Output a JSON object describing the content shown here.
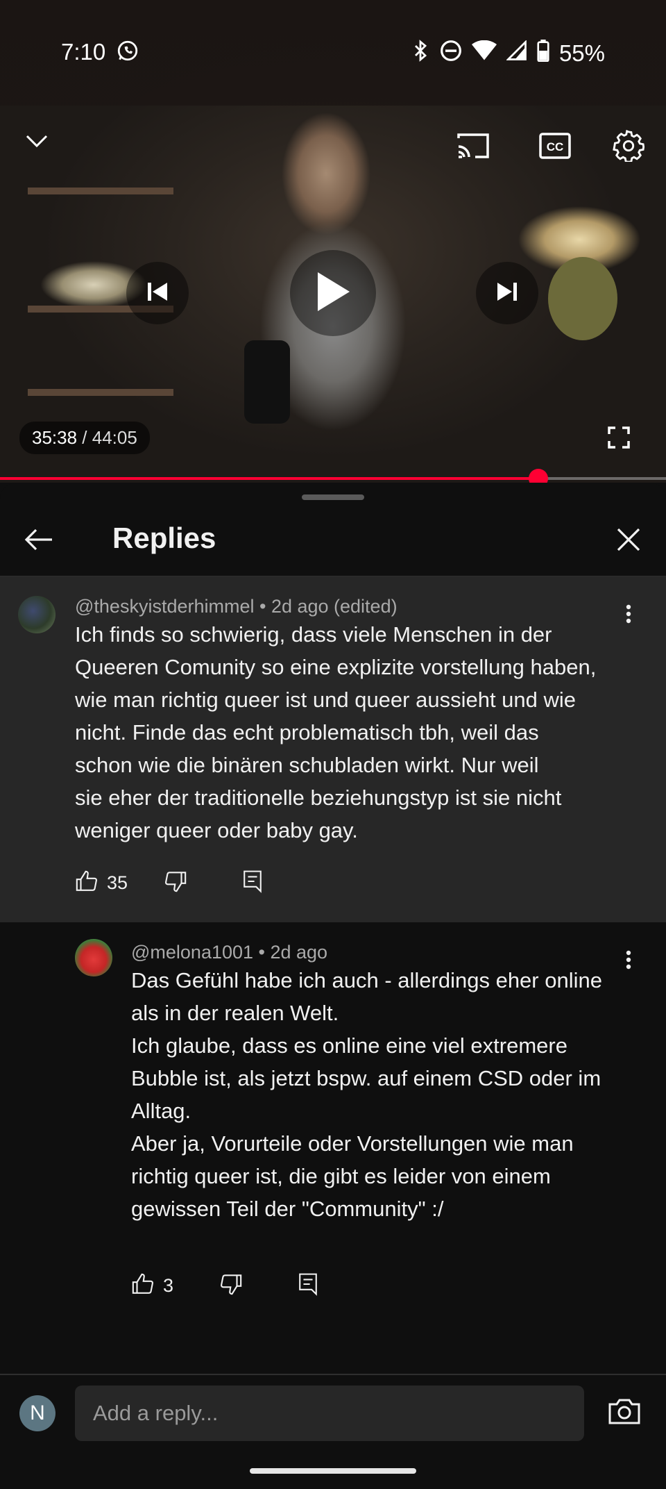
{
  "status_bar": {
    "time": "7:10",
    "battery": "55%",
    "icons": [
      "whatsapp-icon",
      "bluetooth-icon",
      "do-not-disturb-icon",
      "wifi-icon",
      "signal-icon",
      "battery-icon"
    ]
  },
  "player": {
    "current_time": "35:38",
    "separator": " / ",
    "duration": "44:05",
    "progress": 0.808,
    "accent_color": "#ff0033"
  },
  "panel": {
    "title": "Replies"
  },
  "comments": [
    {
      "author": "@theskyistderhimmel",
      "meta": " • 2d ago (edited)",
      "text": "Ich finds so schwierig, dass viele Menschen in der\nQueeren Comunity so eine explizite vorstellung haben,\nwie man richtig queer ist und queer aussieht und wie\nnicht.  Finde das echt problematisch tbh, weil das\nschon wie die binären schubladen wirkt. Nur weil\nsie eher der traditionelle beziehungstyp ist sie nicht\nweniger queer oder baby gay.",
      "likes": "35"
    },
    {
      "author": "@melona1001",
      "meta": " • 2d ago",
      "text": "Das Gefühl habe ich auch - allerdings eher online\nals in der realen Welt.\nIch glaube, dass es online eine viel extremere\nBubble ist, als jetzt bspw. auf einem CSD oder im\nAlltag.\nAber ja, Vorurteile oder Vorstellungen wie man\nrichtig queer ist, die gibt es leider von einem\ngewissen Teil der \"Community\" :/",
      "likes": "3"
    }
  ],
  "reply_box": {
    "placeholder": "Add a reply...",
    "user_initial": "N"
  }
}
